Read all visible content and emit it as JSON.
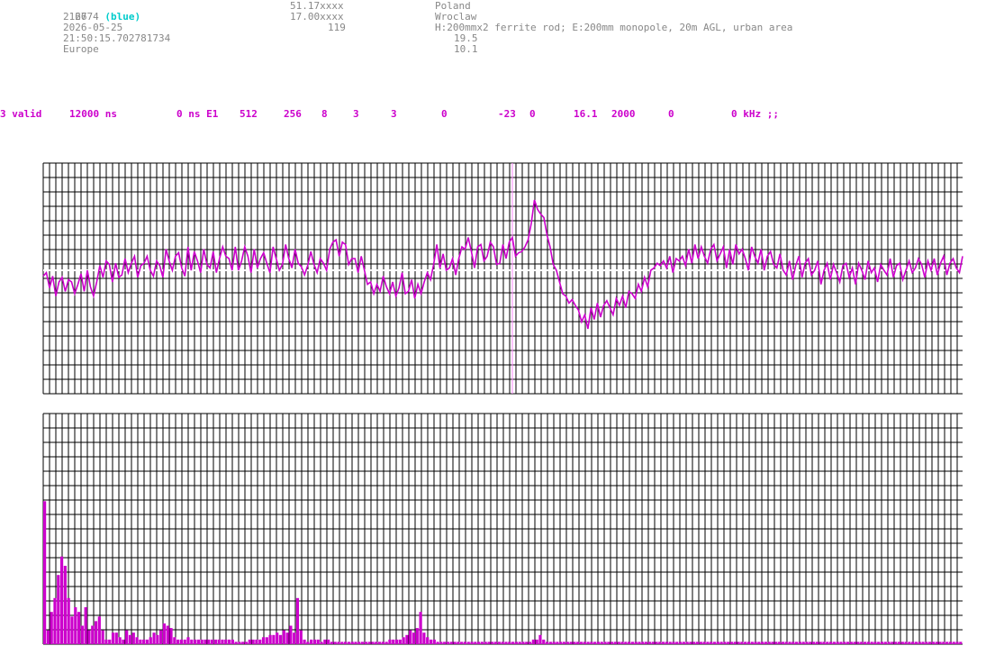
{
  "header": {
    "col1": {
      "id": "2774",
      "id_color_label": "(blue)",
      "line2": "2166",
      "date": "2026-05-25",
      "time": "21:50:15.702781734",
      "region": "Europe"
    },
    "col2": {
      "lat": "51.17xxxx",
      "lon": "17.00xxxx",
      "alt": "119"
    },
    "col3": {
      "country": "Poland",
      "city": "Wroclaw",
      "antenna": "H:200mmx2 ferrite rod; E:200mm monopole, 20m AGL, urban area",
      "v1": "19.5",
      "v2": "10.1"
    }
  },
  "status_line": {
    "valid": "3 valid",
    "window": "12000 ns",
    "offset": "0 ns E1",
    "n1": "512",
    "n2": "256",
    "n3": "8",
    "n4": "3",
    "n5": "3",
    "n6": "0",
    "n7": "-23",
    "n8": "0",
    "n9": "16.1",
    "n10": "2000",
    "n11": "0",
    "tail": "0 kHz ;;"
  },
  "colors": {
    "trace": "#cc00cc",
    "grid": "#000000",
    "marker": "#ff88ff",
    "zero_line": "#ffffff"
  },
  "chart_data": [
    {
      "type": "line",
      "name_hint": "waveform",
      "grid": true,
      "ylim": [
        -1,
        1
      ],
      "peak_index": 128,
      "y": [
        -0.05,
        -0.02,
        -0.15,
        -0.05,
        -0.22,
        -0.1,
        -0.06,
        -0.18,
        -0.08,
        -0.1,
        -0.2,
        -0.12,
        -0.03,
        -0.18,
        0.0,
        -0.14,
        -0.22,
        -0.1,
        0.04,
        -0.06,
        0.08,
        0.05,
        -0.1,
        0.06,
        -0.06,
        -0.04,
        0.1,
        -0.02,
        0.06,
        0.12,
        -0.06,
        0.04,
        0.06,
        0.12,
        0.0,
        -0.05,
        0.08,
        0.04,
        -0.06,
        0.18,
        0.08,
        0.0,
        0.12,
        0.15,
        0.02,
        -0.05,
        0.2,
        0.0,
        0.16,
        0.08,
        -0.02,
        0.18,
        0.05,
        0.02,
        0.16,
        -0.02,
        0.1,
        0.2,
        0.12,
        0.1,
        0.0,
        0.2,
        0.0,
        0.08,
        0.2,
        0.12,
        -0.02,
        0.18,
        0.02,
        0.1,
        0.15,
        0.06,
        -0.02,
        0.2,
        0.1,
        0.0,
        0.05,
        0.22,
        0.1,
        0.02,
        0.18,
        0.06,
        0.03,
        -0.04,
        0.04,
        0.16,
        0.05,
        -0.02,
        0.1,
        0.06,
        0.0,
        0.18,
        0.24,
        0.26,
        0.12,
        0.24,
        0.22,
        0.05,
        0.1,
        0.1,
        -0.02,
        0.12,
        0.0,
        -0.12,
        -0.1,
        -0.2,
        -0.12,
        -0.18,
        -0.05,
        -0.14,
        -0.2,
        -0.1,
        -0.22,
        -0.15,
        -0.02,
        -0.2,
        -0.18,
        -0.08,
        -0.24,
        -0.12,
        -0.2,
        -0.1,
        -0.02,
        -0.08,
        0.05,
        0.22,
        0.02,
        0.14,
        0.0,
        0.02,
        0.1,
        -0.04,
        0.1,
        0.2,
        0.18,
        0.28,
        0.16,
        0.02,
        0.2,
        0.22,
        0.08,
        0.12,
        0.24,
        0.2,
        0.05,
        0.06,
        0.22,
        0.1,
        0.24,
        0.28,
        0.12,
        0.15,
        0.16,
        0.2,
        0.26,
        0.4,
        0.6,
        0.52,
        0.48,
        0.45,
        0.3,
        0.2,
        0.05,
        0.0,
        -0.1,
        -0.2,
        -0.22,
        -0.28,
        -0.25,
        -0.3,
        -0.34,
        -0.44,
        -0.38,
        -0.5,
        -0.32,
        -0.42,
        -0.28,
        -0.4,
        -0.3,
        -0.26,
        -0.32,
        -0.38,
        -0.24,
        -0.3,
        -0.22,
        -0.32,
        -0.18,
        -0.2,
        -0.24,
        -0.12,
        -0.18,
        -0.06,
        -0.14,
        0.0,
        0.02,
        0.06,
        0.04,
        0.08,
        0.02,
        0.12,
        -0.02,
        0.1,
        0.08,
        0.12,
        0.04,
        0.18,
        0.06,
        0.22,
        0.1,
        0.2,
        0.12,
        0.06,
        0.18,
        0.22,
        0.08,
        0.14,
        0.2,
        0.02,
        0.18,
        0.05,
        0.22,
        0.14,
        0.18,
        0.1,
        0.0,
        0.2,
        0.12,
        0.06,
        0.18,
        0.0,
        0.12,
        0.16,
        0.05,
        0.02,
        0.14,
        0.0,
        -0.04,
        0.08,
        -0.08,
        0.04,
        0.12,
        -0.06,
        0.06,
        0.1,
        -0.04,
        0.0,
        0.08,
        -0.12,
        0.0,
        0.06,
        -0.08,
        0.05,
        -0.02,
        -0.1,
        0.04,
        0.06,
        -0.06,
        0.02,
        -0.12,
        0.06,
        0.0,
        -0.08,
        0.08,
        -0.02,
        0.02,
        -0.1,
        0.05,
        0.0,
        -0.04,
        0.1,
        -0.06,
        0.04,
        0.06,
        -0.08,
        0.0,
        0.08,
        -0.02,
        0.02,
        0.1,
        0.05,
        -0.06,
        0.08,
        0.0,
        0.1,
        -0.04,
        0.06,
        0.12,
        -0.04,
        0.06,
        0.1,
        0.02,
        -0.02,
        0.12
      ]
    },
    {
      "type": "bar",
      "name_hint": "spectrum",
      "grid": true,
      "ylim": [
        0,
        1
      ],
      "values": [
        0.62,
        0.06,
        0.14,
        0.2,
        0.3,
        0.38,
        0.34,
        0.2,
        0.12,
        0.16,
        0.14,
        0.08,
        0.16,
        0.06,
        0.08,
        0.1,
        0.12,
        0.06,
        0.02,
        0.02,
        0.05,
        0.05,
        0.03,
        0.02,
        0.06,
        0.04,
        0.05,
        0.03,
        0.02,
        0.02,
        0.02,
        0.03,
        0.05,
        0.04,
        0.06,
        0.09,
        0.08,
        0.07,
        0.03,
        0.02,
        0.02,
        0.02,
        0.03,
        0.02,
        0.02,
        0.02,
        0.02,
        0.02,
        0.02,
        0.02,
        0.02,
        0.02,
        0.02,
        0.02,
        0.02,
        0.02,
        0.01,
        0.01,
        0.01,
        0.01,
        0.02,
        0.02,
        0.02,
        0.02,
        0.03,
        0.03,
        0.04,
        0.04,
        0.05,
        0.04,
        0.06,
        0.05,
        0.08,
        0.05,
        0.2,
        0.06,
        0.02,
        0.01,
        0.02,
        0.02,
        0.02,
        0.01,
        0.02,
        0.02,
        0.01,
        0.01,
        0.01,
        0.01,
        0.01,
        0.01,
        0.01,
        0.01,
        0.01,
        0.01,
        0.01,
        0.01,
        0.01,
        0.01,
        0.01,
        0.01,
        0.01,
        0.02,
        0.02,
        0.02,
        0.02,
        0.03,
        0.04,
        0.06,
        0.05,
        0.07,
        0.14,
        0.05,
        0.03,
        0.02,
        0.02,
        0.01,
        0.01,
        0.01,
        0.01,
        0.01,
        0.01,
        0.01,
        0.01,
        0.01,
        0.01,
        0.01,
        0.01,
        0.01,
        0.01,
        0.01,
        0.01,
        0.01,
        0.01,
        0.01,
        0.01,
        0.01,
        0.01,
        0.01,
        0.01,
        0.01,
        0.01,
        0.01,
        0.01,
        0.02,
        0.02,
        0.04,
        0.02,
        0.01,
        0.01,
        0.01,
        0.01,
        0.01,
        0.01,
        0.01,
        0.01,
        0.01,
        0.01,
        0.01,
        0.01,
        0.01,
        0.01,
        0.01,
        0.01,
        0.01,
        0.01,
        0.01,
        0.01,
        0.01,
        0.01,
        0.01,
        0.01,
        0.01,
        0.01,
        0.01,
        0.01,
        0.01,
        0.01,
        0.01,
        0.01,
        0.01,
        0.01,
        0.01,
        0.01,
        0.01,
        0.01,
        0.01,
        0.01,
        0.01,
        0.01,
        0.01,
        0.01,
        0.01,
        0.01,
        0.01,
        0.01,
        0.01,
        0.01,
        0.01,
        0.01,
        0.01,
        0.01,
        0.01,
        0.01,
        0.01,
        0.01,
        0.01,
        0.01,
        0.01,
        0.01,
        0.01,
        0.01,
        0.01,
        0.01,
        0.01,
        0.01,
        0.01,
        0.01,
        0.01,
        0.01,
        0.01,
        0.01,
        0.01,
        0.01,
        0.01,
        0.01,
        0.01,
        0.01,
        0.01,
        0.01,
        0.01,
        0.01,
        0.01,
        0.01,
        0.01,
        0.01,
        0.01,
        0.01,
        0.01,
        0.01,
        0.01,
        0.01,
        0.01,
        0.01,
        0.01,
        0.01,
        0.01,
        0.01,
        0.01,
        0.01,
        0.01,
        0.01,
        0.01,
        0.01,
        0.01,
        0.01,
        0.01,
        0.01,
        0.01,
        0.01,
        0.01,
        0.01,
        0.01,
        0.01,
        0.01,
        0.01,
        0.01,
        0.01,
        0.01,
        0.01
      ]
    }
  ]
}
